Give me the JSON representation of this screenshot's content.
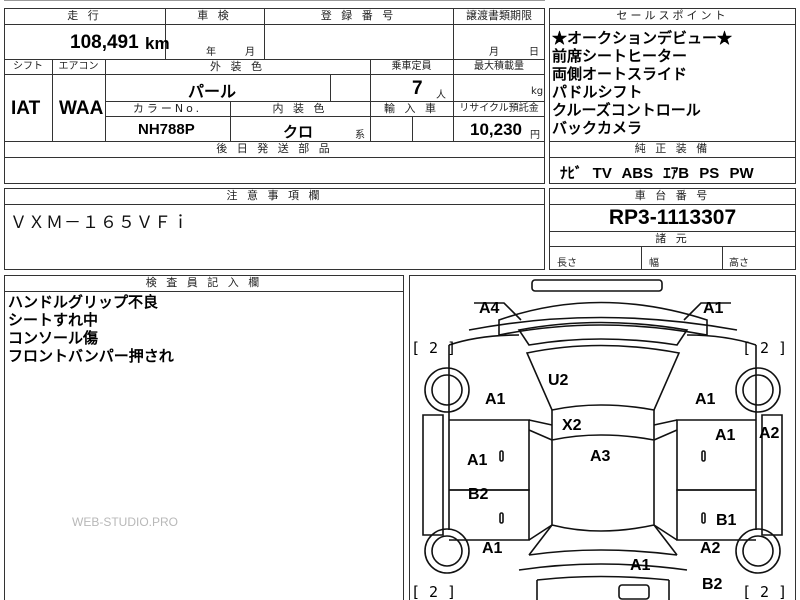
{
  "top": {
    "mileage_label": "走 行",
    "mileage_value": "108,491",
    "mileage_unit": "km",
    "inspection_label": "車 検",
    "inspection_year_unit": "年",
    "inspection_month_unit": "月",
    "registration_label": "登 録 番 号",
    "transfer_label": "譲渡書類期限",
    "transfer_month_unit": "月",
    "transfer_day_unit": "日",
    "shift_label": "シフト",
    "shift_value": "IAT",
    "ac_label": "エアコン",
    "ac_value": "WAA",
    "exterior_label": "外 装 色",
    "exterior_value": "パール",
    "capacity_label": "乗車定員",
    "capacity_value": "7",
    "capacity_unit": "人",
    "load_label": "最大積載量",
    "load_unit": "kg",
    "color_no_label": "カラーNo.",
    "color_no_value": "NH788P",
    "interior_label": "内 装 色",
    "interior_value": "クロ",
    "interior_suffix": "系",
    "import_label": "輸 入 車",
    "recycle_label": "リサイクル預託金",
    "recycle_value": "10,230",
    "recycle_unit": "円",
    "later_parts_label": "後 日 発 送 部 品"
  },
  "sales_points": {
    "label": "セールスポイント",
    "items": [
      "★オークションデビュー★",
      "前席シートヒーター",
      "両側オートスライド",
      "パドルシフト",
      "クルーズコントロール",
      "バックカメラ"
    ]
  },
  "genuine": {
    "label": "純 正 装 備",
    "value": "ﾅﾋﾞ TV ABS ｴｱB PS PW"
  },
  "caution": {
    "label": "注 意 事 項 欄",
    "value": "ＶＸＭ－１６５ＶＦｉ"
  },
  "chassis": {
    "label": "車 台 番 号",
    "value": "RP3-1113307",
    "dims_label": "諸 元",
    "length_label": "長さ",
    "width_label": "幅",
    "height_label": "高さ"
  },
  "inspector": {
    "label": "検 査 員 記 入 欄",
    "notes": [
      "ハンドルグリップ不良",
      "シートすれ中",
      "コンソール傷",
      "フロントバンパー押され"
    ]
  },
  "watermark": "WEB-STUDIO.PRO",
  "diagram": {
    "marks": {
      "a4_top_left": "A4",
      "a1_top_right": "A1",
      "bracket_tl": "[ 2 ]",
      "bracket_tr": "[ 2 ]",
      "bracket_bl": "[ 2 ]",
      "bracket_br": "[ 2 ]",
      "u2_windshield": "U2",
      "a1_left_front_wheel": "A1",
      "a1_right_front_wheel": "A1",
      "x2_roof": "X2",
      "a3_roof": "A3",
      "a1_right_front_door": "A1",
      "a2_right_edge": "A2",
      "a1_left_front_door": "A1",
      "b2_left_rear_door": "B2",
      "b1_right_rear_door": "B1",
      "a1_left_rear_wheel": "A1",
      "a2_right_rear_wheel": "A2",
      "a1_rear": "A1",
      "b2_rear_right": "B2"
    }
  }
}
